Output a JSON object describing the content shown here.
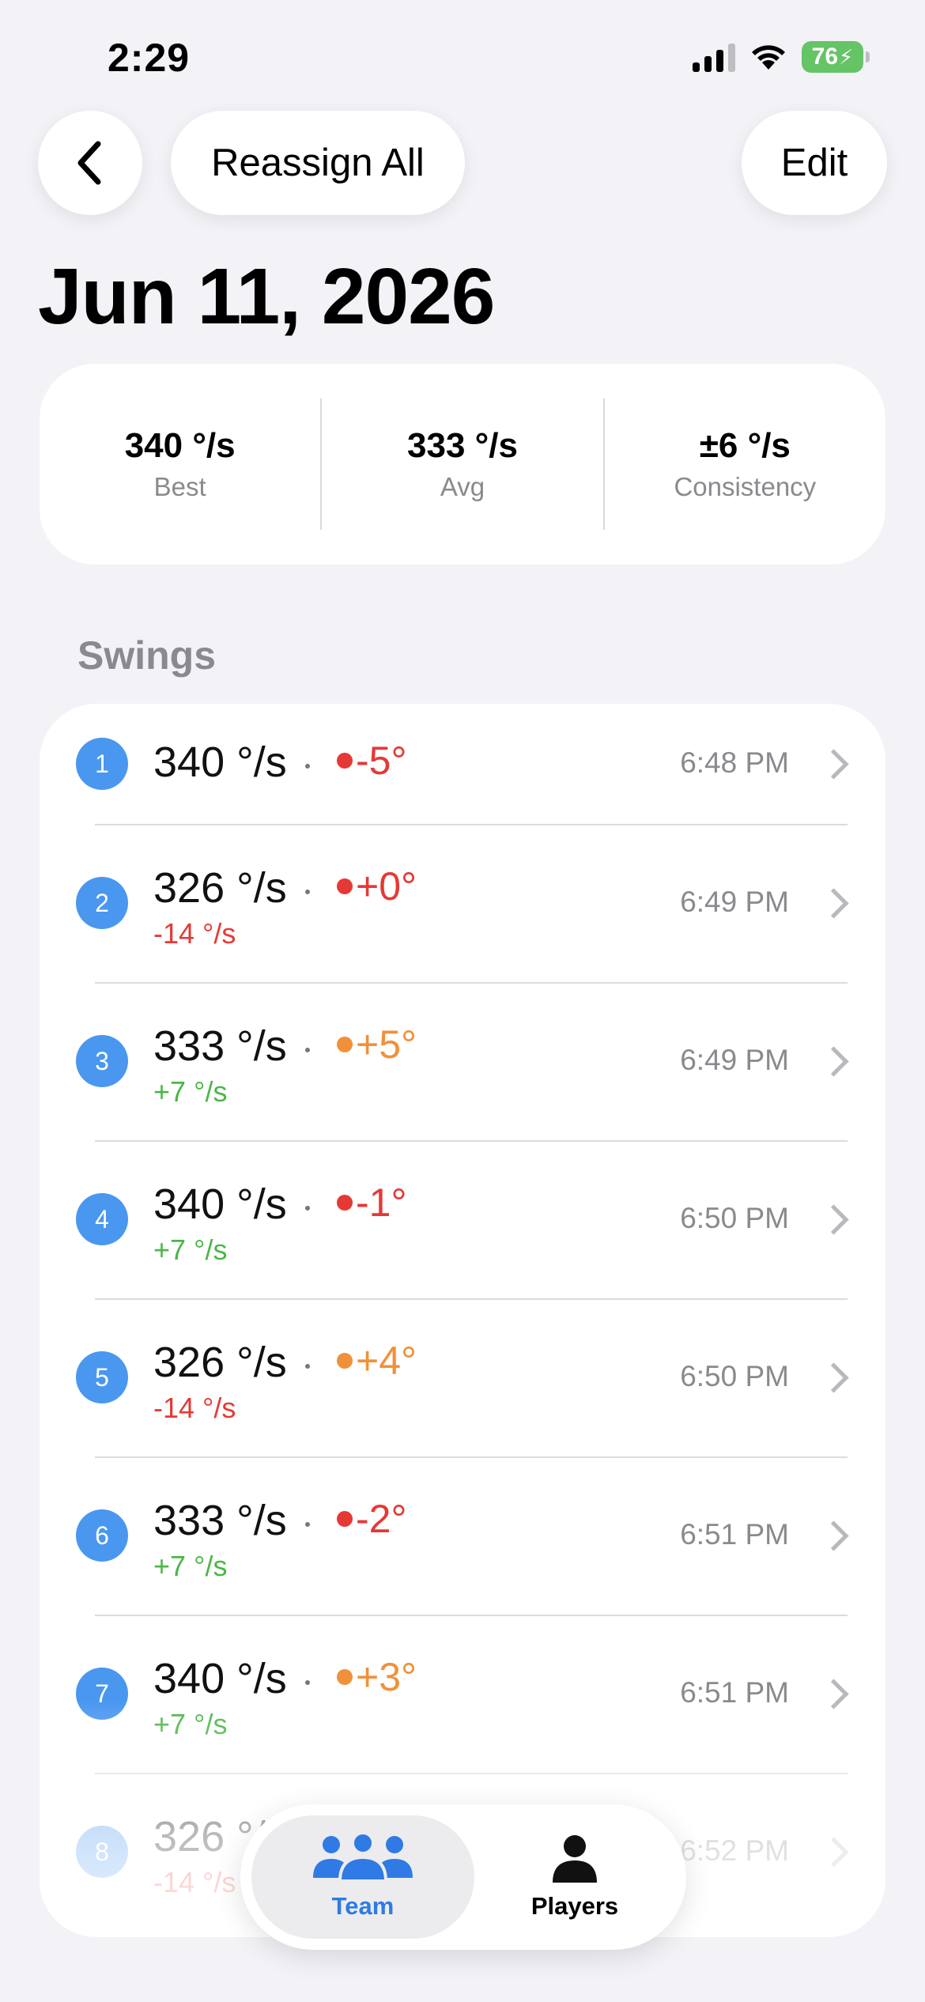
{
  "status_bar": {
    "time": "2:29",
    "battery": "76"
  },
  "nav": {
    "reassign_label": "Reassign All",
    "edit_label": "Edit"
  },
  "title": "Jun 11, 2026",
  "stats": [
    {
      "value": "340 °/s",
      "label": "Best"
    },
    {
      "value": "333 °/s",
      "label": "Avg"
    },
    {
      "value": "±6 °/s",
      "label": "Consistency"
    }
  ],
  "section_title": "Swings",
  "swings": [
    {
      "num": "1",
      "speed": "340 °/s",
      "angle": "-5°",
      "angle_color": "#e53935",
      "delta": "",
      "delta_color": "#e53935",
      "time": "6:48 PM"
    },
    {
      "num": "2",
      "speed": "326 °/s",
      "angle": "+0°",
      "angle_color": "#e53935",
      "delta": "-14 °/s",
      "delta_color": "#e53935",
      "time": "6:49 PM"
    },
    {
      "num": "3",
      "speed": "333 °/s",
      "angle": "+5°",
      "angle_color": "#f0913a",
      "delta": "+7 °/s",
      "delta_color": "#4cb648",
      "time": "6:49 PM"
    },
    {
      "num": "4",
      "speed": "340 °/s",
      "angle": "-1°",
      "angle_color": "#e53935",
      "delta": "+7 °/s",
      "delta_color": "#4cb648",
      "time": "6:50 PM"
    },
    {
      "num": "5",
      "speed": "326 °/s",
      "angle": "+4°",
      "angle_color": "#f0913a",
      "delta": "-14 °/s",
      "delta_color": "#e53935",
      "time": "6:50 PM"
    },
    {
      "num": "6",
      "speed": "333 °/s",
      "angle": "-2°",
      "angle_color": "#e53935",
      "delta": "+7 °/s",
      "delta_color": "#4cb648",
      "time": "6:51 PM"
    },
    {
      "num": "7",
      "speed": "340 °/s",
      "angle": "+3°",
      "angle_color": "#f0913a",
      "delta": "+7 °/s",
      "delta_color": "#4cb648",
      "time": "6:51 PM"
    },
    {
      "num": "8",
      "speed": "326 °/s",
      "angle": "",
      "angle_color": "#e53935",
      "delta": "-14 °/s",
      "delta_color": "#e53935",
      "time": "6:52 PM"
    }
  ],
  "tabs": [
    {
      "label": "Team",
      "icon": "people-icon",
      "active": true
    },
    {
      "label": "Players",
      "icon": "person-icon",
      "active": false
    }
  ],
  "colors": {
    "accent": "#2f7ae5",
    "badge": "#4a97f0",
    "positive": "#4cb648",
    "negative": "#e53935",
    "warning": "#f0913a"
  }
}
